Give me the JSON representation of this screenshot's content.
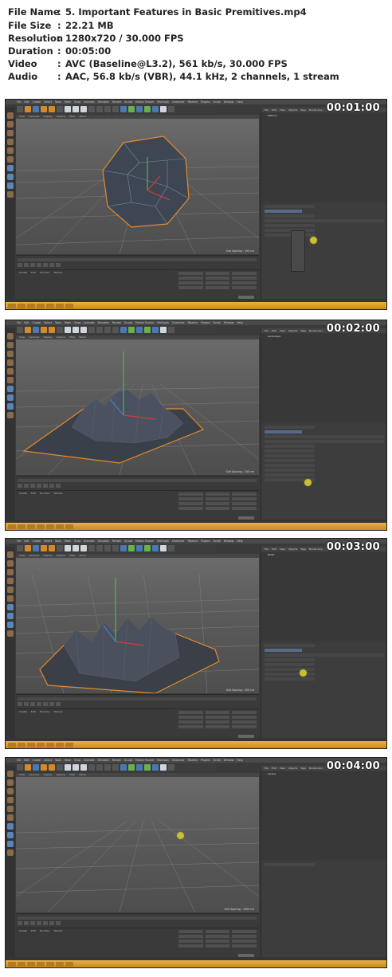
{
  "info": {
    "rows": [
      {
        "key": "File Name",
        "value": "5. Important Features in Basic Premitives.mp4"
      },
      {
        "key": "File Size",
        "value": "22.21 MB"
      },
      {
        "key": "Resolution",
        "value": "1280x720 / 30.000 FPS"
      },
      {
        "key": "Duration",
        "value": "00:05:00"
      },
      {
        "key": "Video",
        "value": "AVC (Baseline@L3.2), 561 kb/s, 30.000 FPS"
      },
      {
        "key": "Audio",
        "value": "AAC, 56.8 kb/s (VBR), 44.1 kHz, 2 channels, 1 stream"
      }
    ],
    "separator": ":"
  },
  "frames": [
    {
      "timecode": "00:01:00",
      "object": "platonic"
    },
    {
      "timecode": "00:02:00",
      "object": "landscape"
    },
    {
      "timecode": "00:03:00",
      "object": "relief"
    },
    {
      "timecode": "00:04:00",
      "object": "empty"
    }
  ],
  "colors": {
    "taskbar": "#e9b23f",
    "object_outline": "#e58a2a",
    "mesh": "#3e4654"
  }
}
